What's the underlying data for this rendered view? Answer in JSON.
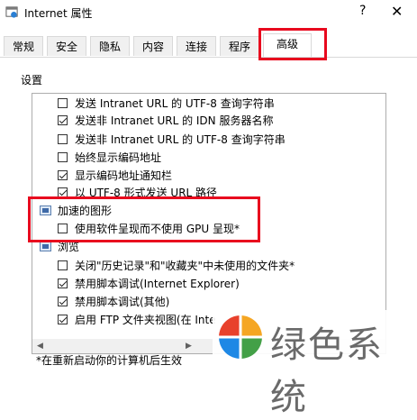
{
  "window": {
    "title": "Internet 属性",
    "help_label": "?",
    "close_label": "✕"
  },
  "tabs": [
    {
      "label": "常规"
    },
    {
      "label": "安全"
    },
    {
      "label": "隐私"
    },
    {
      "label": "内容"
    },
    {
      "label": "连接"
    },
    {
      "label": "程序"
    },
    {
      "label": "高级"
    }
  ],
  "active_tab": "高级",
  "settings": {
    "section_label": "设置",
    "rows": [
      {
        "type": "checkbox",
        "label": "发送 Intranet URL 的 UTF-8 查询字符串",
        "checked": false
      },
      {
        "type": "checkbox",
        "label": "发送非 Intranet URL 的 IDN 服务器名称",
        "checked": true
      },
      {
        "type": "checkbox",
        "label": "发送非 Intranet URL 的 UTF-8 查询字符串",
        "checked": false
      },
      {
        "type": "checkbox",
        "label": "始终显示编码地址",
        "checked": false
      },
      {
        "type": "checkbox",
        "label": "显示编码地址通知栏",
        "checked": true
      },
      {
        "type": "checkbox",
        "label": "以 UTF-8 形式发送 URL 路径",
        "checked": true
      },
      {
        "type": "group",
        "label": "加速的图形"
      },
      {
        "type": "checkbox",
        "label": "使用软件呈现而不使用 GPU 呈现*",
        "checked": false
      },
      {
        "type": "group",
        "label": "浏览"
      },
      {
        "type": "checkbox",
        "label": "关闭\"历史记录\"和\"收藏夹\"中未使用的文件夹*",
        "checked": false
      },
      {
        "type": "checkbox",
        "label": "禁用脚本调试(Internet Explorer)",
        "checked": true
      },
      {
        "type": "checkbox",
        "label": "禁用脚本调试(其他)",
        "checked": true
      },
      {
        "type": "checkbox",
        "label": "启用 FTP 文件夹视图(在 Inte",
        "checked": true
      }
    ],
    "scroll_arrows": {
      "left": "◀",
      "right": "▶",
      "up": "▲",
      "down": "▼"
    }
  },
  "footnote": "*在重新启动你的计算机后生效",
  "watermark": {
    "text": "绿色系统"
  },
  "colors": {
    "highlight": "#e8091e",
    "check": "#222222"
  }
}
